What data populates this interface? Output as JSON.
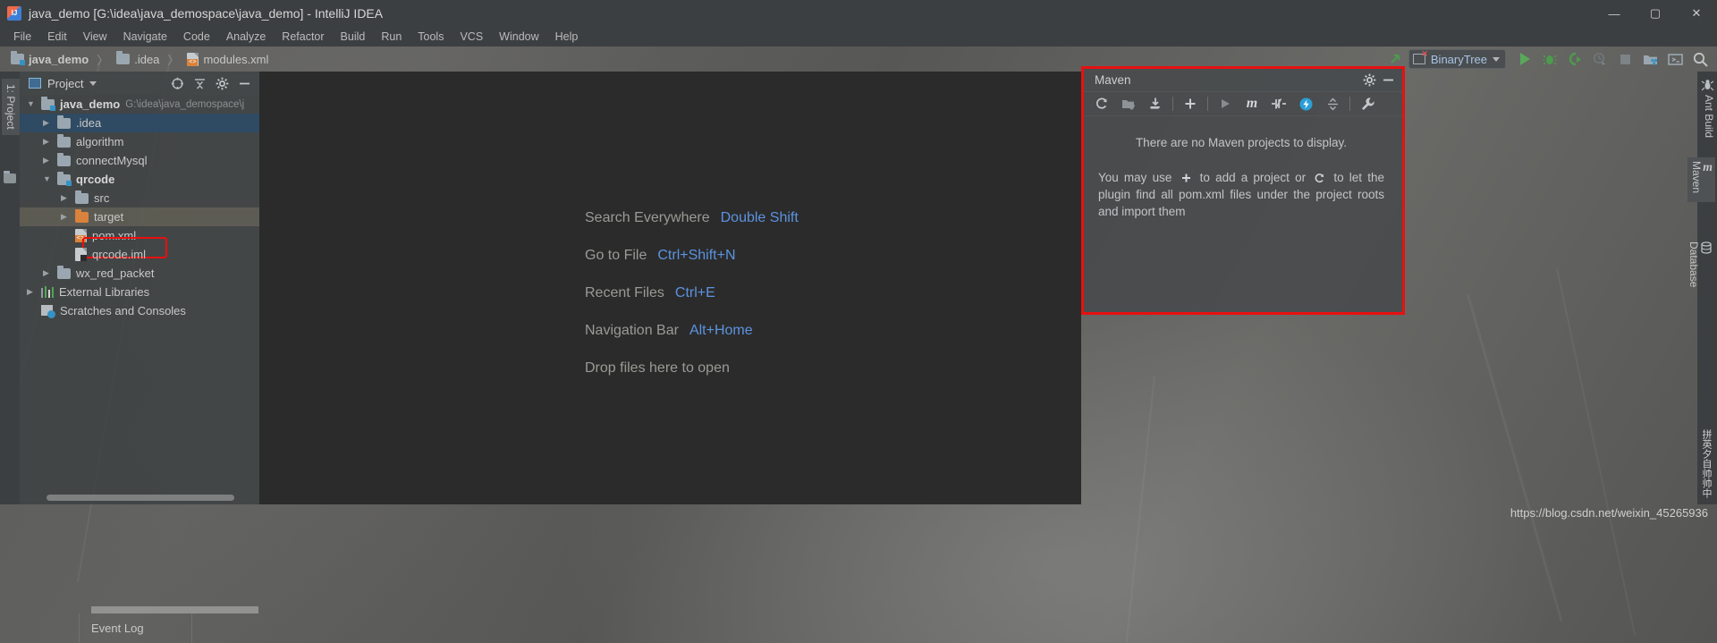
{
  "window": {
    "title": "java_demo [G:\\idea\\java_demospace\\java_demo] - IntelliJ IDEA",
    "app_icon": "intellij-idea-logo",
    "minimize": "—",
    "maximize": "▢",
    "close": "✕"
  },
  "menubar": {
    "items": [
      {
        "label": "File",
        "mnemonic": "F"
      },
      {
        "label": "Edit",
        "mnemonic": "E"
      },
      {
        "label": "View",
        "mnemonic": "V"
      },
      {
        "label": "Navigate",
        "mnemonic": "g"
      },
      {
        "label": "Code",
        "mnemonic": "C"
      },
      {
        "label": "Analyze",
        "mnemonic": "z"
      },
      {
        "label": "Refactor",
        "mnemonic": "R"
      },
      {
        "label": "Build",
        "mnemonic": "B"
      },
      {
        "label": "Run",
        "mnemonic": "u"
      },
      {
        "label": "Tools",
        "mnemonic": "T"
      },
      {
        "label": "VCS",
        "mnemonic": "S"
      },
      {
        "label": "Window",
        "mnemonic": "W"
      },
      {
        "label": "Help",
        "mnemonic": "H"
      }
    ]
  },
  "navbar": {
    "breadcrumbs": [
      {
        "label": "java_demo",
        "icon": "module-folder-icon"
      },
      {
        "label": ".idea",
        "icon": "folder-icon"
      },
      {
        "label": "modules.xml",
        "icon": "xml-file-icon"
      }
    ],
    "separator": "〉",
    "toolbar": {
      "update_project_icon": "update-project-arrow-icon",
      "run_config_name": "BinaryTree",
      "run_config_icon": "run-config-error-icon",
      "dropdown_icon": "chevron-down-icon",
      "run_icon": "run-icon",
      "debug_icon": "debug-bug-icon",
      "coverage_icon": "run-with-coverage-icon",
      "profile_icon": "profile-icon",
      "stop_icon": "stop-icon",
      "project_structure_icon": "project-structure-icon",
      "terminal_icon": "terminal-icon",
      "search_icon": "search-icon"
    }
  },
  "left_strip": {
    "tabs": [
      {
        "label": "1: Project",
        "selected": true
      },
      {
        "label": "",
        "icon": "structure-icon",
        "selected": false
      }
    ]
  },
  "project_panel": {
    "title": "Project",
    "title_icon": "project-view-icon",
    "dropdown_icon": "chevron-down-icon",
    "tools": [
      {
        "name": "locate-icon"
      },
      {
        "name": "collapse-all-icon"
      },
      {
        "name": "gear-icon"
      },
      {
        "name": "hide-icon"
      }
    ],
    "tree": [
      {
        "label": "java_demo",
        "suffix": "G:\\idea\\java_demospace\\j",
        "indent": 0,
        "arrow": "down",
        "icon": "module-folder-icon",
        "bold": true,
        "state": "normal"
      },
      {
        "label": ".idea",
        "suffix": "",
        "indent": 1,
        "arrow": "right",
        "icon": "folder-icon",
        "bold": false,
        "state": "selected"
      },
      {
        "label": "algorithm",
        "suffix": "",
        "indent": 1,
        "arrow": "right",
        "icon": "folder-icon",
        "bold": false,
        "state": "normal"
      },
      {
        "label": "connectMysql",
        "suffix": "",
        "indent": 1,
        "arrow": "right",
        "icon": "folder-icon",
        "bold": false,
        "state": "normal"
      },
      {
        "label": "qrcode",
        "suffix": "",
        "indent": 1,
        "arrow": "down",
        "icon": "module-folder-icon",
        "bold": true,
        "state": "normal"
      },
      {
        "label": "src",
        "suffix": "",
        "indent": 2,
        "arrow": "right",
        "icon": "folder-icon",
        "bold": false,
        "state": "normal"
      },
      {
        "label": "target",
        "suffix": "",
        "indent": 2,
        "arrow": "right",
        "icon": "folder-orange-icon",
        "bold": false,
        "state": "highlight"
      },
      {
        "label": "pom.xml",
        "suffix": "",
        "indent": 2,
        "arrow": "none",
        "icon": "xml-file-icon",
        "bold": false,
        "state": "boxed"
      },
      {
        "label": "qrcode.iml",
        "suffix": "",
        "indent": 2,
        "arrow": "none",
        "icon": "iml-file-icon",
        "bold": false,
        "state": "normal"
      },
      {
        "label": "wx_red_packet",
        "suffix": "",
        "indent": 1,
        "arrow": "right",
        "icon": "folder-icon",
        "bold": false,
        "state": "normal"
      },
      {
        "label": "External Libraries",
        "suffix": "",
        "indent": 0,
        "arrow": "right",
        "icon": "libraries-icon",
        "bold": false,
        "state": "normal"
      },
      {
        "label": "Scratches and Consoles",
        "suffix": "",
        "indent": 0,
        "arrow": "none",
        "icon": "scratches-icon",
        "bold": false,
        "state": "normal"
      }
    ]
  },
  "editor": {
    "hints": [
      {
        "label": "Search Everywhere",
        "key": "Double Shift"
      },
      {
        "label": "Go to File",
        "key": "Ctrl+Shift+N"
      },
      {
        "label": "Recent Files",
        "key": "Ctrl+E"
      },
      {
        "label": "Navigation Bar",
        "key": "Alt+Home"
      },
      {
        "label": "Drop files here to open",
        "key": ""
      }
    ]
  },
  "maven_panel": {
    "title": "Maven",
    "highlight_color": "#e81010",
    "header_tools": [
      {
        "name": "gear-icon"
      },
      {
        "name": "hide-icon"
      }
    ],
    "toolbar": [
      {
        "name": "reimport-refresh-icon"
      },
      {
        "name": "generate-sources-folder-icon"
      },
      {
        "name": "download-sources-icon"
      },
      {
        "name": "add-maven-project-icon"
      },
      {
        "name": "run-icon"
      },
      {
        "name": "execute-maven-goal-icon"
      },
      {
        "name": "toggle-skip-tests-icon"
      },
      {
        "name": "toggle-offline-mode-icon"
      },
      {
        "name": "collapse-all-icon"
      },
      {
        "name": "maven-settings-wrench-icon"
      }
    ],
    "empty_message": "There are no Maven projects to display.",
    "help_text_part1": "You may use",
    "help_text_part2": "to add a project or",
    "help_text_part3": "to let the plugin find all pom.xml files under the project roots and import them",
    "plus_icon": "plus-icon",
    "refresh_icon": "refresh-icon"
  },
  "right_strip": {
    "tabs": [
      {
        "label": "Ant Build",
        "icon": "ant-icon",
        "selected": false
      },
      {
        "label": "Maven",
        "icon": "maven-m-icon",
        "selected": true
      },
      {
        "label": "Database",
        "icon": "database-icon",
        "selected": false
      }
    ],
    "ime_text": "拼英夕自帅帅中"
  },
  "status_bar": {
    "event_log": "Event Log"
  },
  "watermark": {
    "text": "https://blog.csdn.net/weixin_45265936"
  }
}
